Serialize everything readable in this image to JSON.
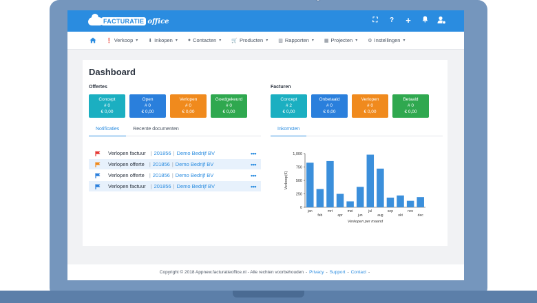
{
  "app": {
    "logo_brand": "FACTURATIE",
    "logo_suffix": "office"
  },
  "topbar": {
    "icons": [
      "expand-icon",
      "help-icon",
      "plus-icon",
      "bell-icon",
      "user-settings-icon"
    ]
  },
  "nav": {
    "home_icon": "home-icon",
    "items": [
      {
        "label": "Verkoop",
        "icon": "exclamation-icon"
      },
      {
        "label": "Inkopen",
        "icon": "download-icon"
      },
      {
        "label": "Contacten",
        "icon": "person-icon"
      },
      {
        "label": "Producten",
        "icon": "cart-icon"
      },
      {
        "label": "Rapporten",
        "icon": "bar-chart-icon"
      },
      {
        "label": "Projecten",
        "icon": "calendar-icon"
      },
      {
        "label": "Instellingen",
        "icon": "gear-icon"
      }
    ]
  },
  "dashboard": {
    "title": "Dashboard",
    "offertes": {
      "label": "Offertes",
      "tiles": [
        {
          "name": "Concept",
          "count": "# 0",
          "amount": "€ 0,00",
          "color": "#1bafc1"
        },
        {
          "name": "Open",
          "count": "# 0",
          "amount": "€ 0,00",
          "color": "#2a7fdc"
        },
        {
          "name": "Verlopen",
          "count": "# 0",
          "amount": "€ 0,00",
          "color": "#f08a1d"
        },
        {
          "name": "Goedgekeurd",
          "count": "# 0",
          "amount": "€ 0,00",
          "color": "#2fa84f"
        }
      ]
    },
    "facturen": {
      "label": "Facturen",
      "tiles": [
        {
          "name": "Concept",
          "count": "# 2",
          "amount": "€ 0,00",
          "color": "#1bafc1"
        },
        {
          "name": "Onbetaald",
          "count": "# 0",
          "amount": "€ 0,00",
          "color": "#2a7fdc"
        },
        {
          "name": "Verlopen",
          "count": "# 0",
          "amount": "€ 0,00",
          "color": "#f08a1d"
        },
        {
          "name": "Betaald",
          "count": "# 0",
          "amount": "€ 0,00",
          "color": "#2fa84f"
        }
      ]
    },
    "left_tabs": [
      "Notificaties",
      "Recente documenten"
    ],
    "right_tabs": [
      "Inkomsten"
    ],
    "notifications": [
      {
        "type": "Verlopen factuur",
        "number": "201856",
        "company": "Demo Bedrijf BV",
        "flag_color": "#e53935"
      },
      {
        "type": "Verlopen offerte",
        "number": "201856",
        "company": "Demo Bedrijf BV",
        "flag_color": "#f08a1d"
      },
      {
        "type": "Verlopen offerte",
        "number": "201856",
        "company": "Demo Bedrijf BV",
        "flag_color": "#2a7fdc"
      },
      {
        "type": "Verlopen factuur",
        "number": "201856",
        "company": "Demo Bedrijf BV",
        "flag_color": "#2a7fdc"
      }
    ],
    "separator": "|",
    "more_label": "•••"
  },
  "chart_data": {
    "type": "bar",
    "categories": [
      "jan",
      "feb",
      "mrt",
      "apr",
      "mei",
      "jun",
      "jul",
      "aug",
      "sep",
      "okt",
      "nov",
      "dec"
    ],
    "values": [
      830,
      340,
      860,
      250,
      110,
      380,
      980,
      720,
      180,
      220,
      120,
      190
    ],
    "ylabel": "Verkoop(€)",
    "xlabel": "Verkopen per maand",
    "ylim": [
      0,
      1000
    ],
    "yticks": [
      "0",
      "250",
      "500",
      "750",
      "1,000"
    ],
    "bar_color": "#3b8fdb",
    "grid": false
  },
  "footer": {
    "copyright": "Copyright © 2018 Appnew.facturatieoffice.nl - Alle rechten voorbehouden",
    "links": [
      "Privacy",
      "Support",
      "Contact"
    ],
    "dash": "-"
  }
}
